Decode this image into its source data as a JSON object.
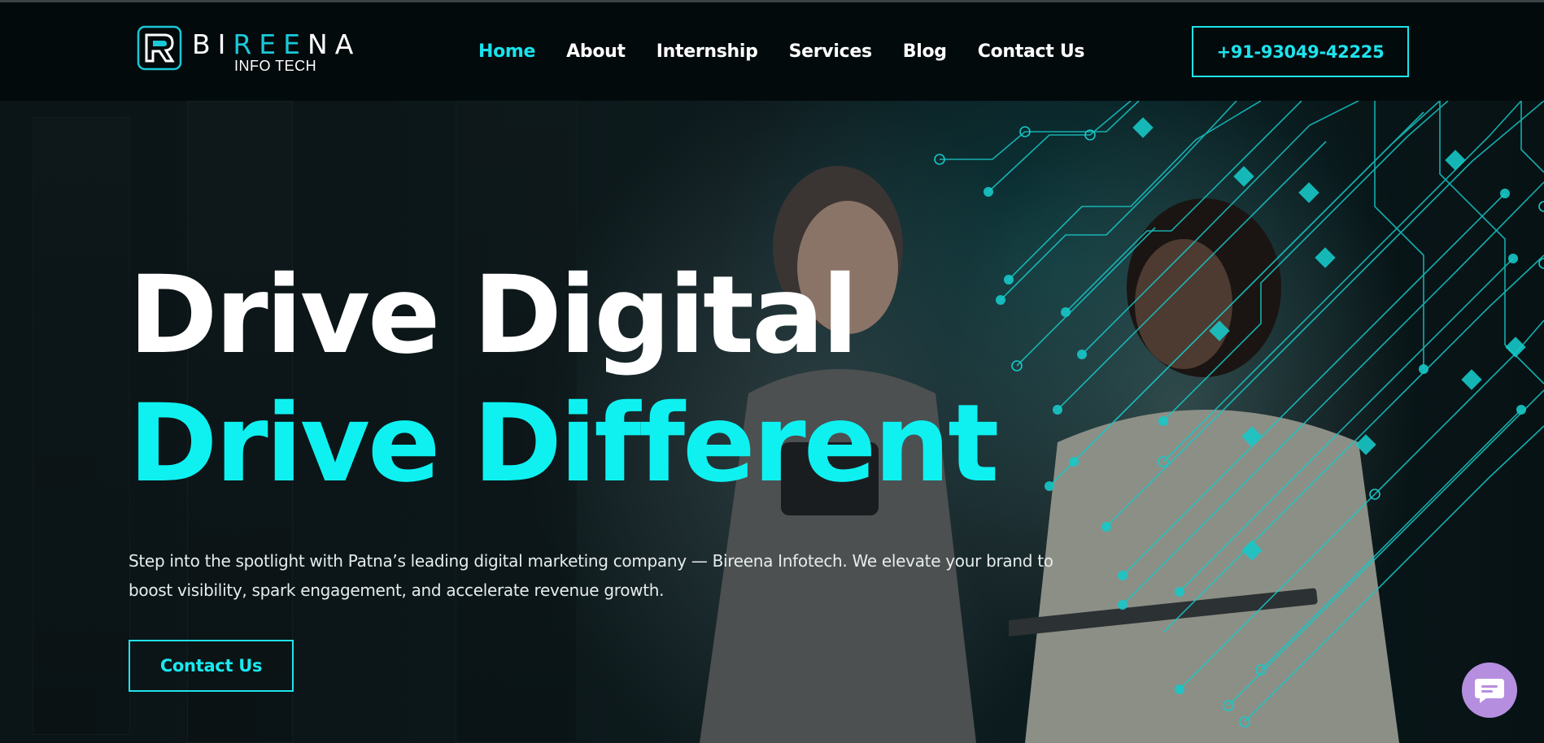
{
  "header": {
    "brand": {
      "part1": "BI",
      "part2": "REE",
      "part3": "NA",
      "tagline": "INFO TECH"
    },
    "nav": [
      {
        "label": "Home",
        "active": true
      },
      {
        "label": "About",
        "active": false
      },
      {
        "label": "Internship",
        "active": false
      },
      {
        "label": "Services",
        "active": false
      },
      {
        "label": "Blog",
        "active": false
      },
      {
        "label": "Contact Us",
        "active": false
      }
    ],
    "phone": "+91-93049-42225"
  },
  "hero": {
    "headline_line1": "Drive Digital",
    "headline_line2": "Drive Different",
    "description": "Step into the spotlight with Patna’s leading digital marketing company — Bireena Infotech. We elevate your brand to boost visibility, spark engagement, and accelerate revenue growth.",
    "cta_label": "Contact Us"
  },
  "colors": {
    "accent": "#0ff1f1",
    "background": "#030a0c",
    "chat_button": "#b58ee0"
  },
  "icons": {
    "logo": "bireena-logo-icon",
    "chat": "chat-bubble-icon"
  }
}
